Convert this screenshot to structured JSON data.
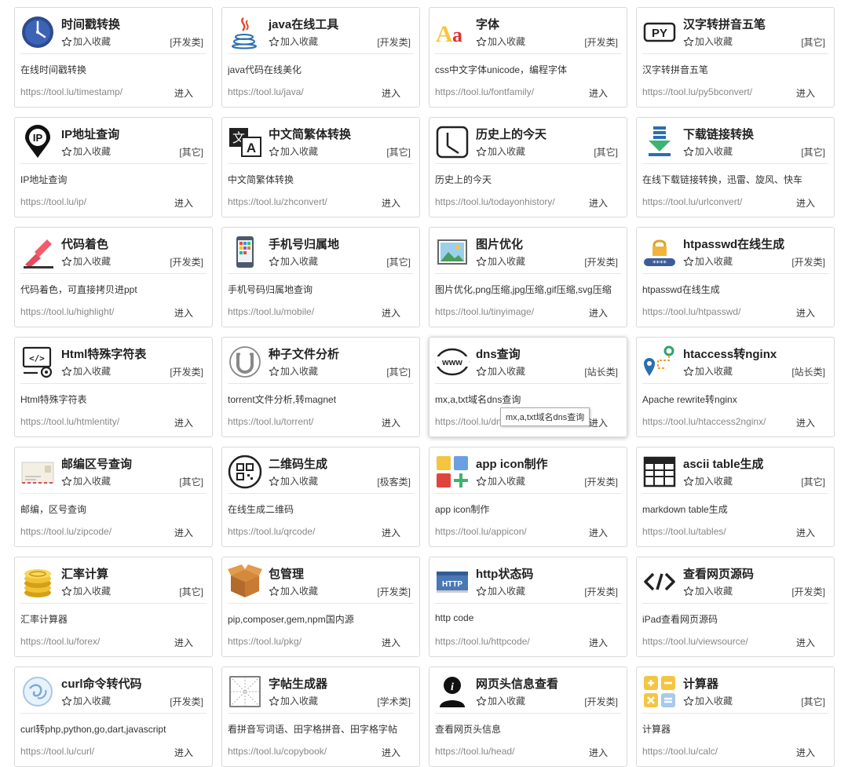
{
  "common": {
    "fav_label": "加入收藏",
    "enter_label": "进入"
  },
  "tooltip": "mx,a,txt域名dns查询",
  "tools": [
    {
      "icon": "clock-icon",
      "title": "时间戳转换",
      "category": "[开发类]",
      "desc": "在线时间戳转换",
      "url": "https://tool.lu/timestamp/"
    },
    {
      "icon": "java-icon",
      "title": "java在线工具",
      "category": "[开发类]",
      "desc": "java代码在线美化",
      "url": "https://tool.lu/java/"
    },
    {
      "icon": "font-icon",
      "title": "字体",
      "category": "[开发类]",
      "desc": "css中文字体unicode，编程字体",
      "url": "https://tool.lu/fontfamily/"
    },
    {
      "icon": "py-icon",
      "title": "汉字转拼音五笔",
      "category": "[其它]",
      "desc": "汉字转拼音五笔",
      "url": "https://tool.lu/py5bconvert/"
    },
    {
      "icon": "ip-pin-icon",
      "title": "IP地址查询",
      "category": "[其它]",
      "desc": "IP地址查询",
      "url": "https://tool.lu/ip/"
    },
    {
      "icon": "translate-icon",
      "title": "中文简繁体转换",
      "category": "[其它]",
      "desc": "中文简繁体转换",
      "url": "https://tool.lu/zhconvert/"
    },
    {
      "icon": "history-clock-icon",
      "title": "历史上的今天",
      "category": "[其它]",
      "desc": "历史上的今天",
      "url": "https://tool.lu/todayonhistory/"
    },
    {
      "icon": "download-icon",
      "title": "下载链接转换",
      "category": "[其它]",
      "desc": "在线下载链接转换，迅雷、旋风、快车",
      "url": "https://tool.lu/urlconvert/"
    },
    {
      "icon": "highlighter-icon",
      "title": "代码着色",
      "category": "[开发类]",
      "desc": "代码着色，可直接拷贝进ppt",
      "url": "https://tool.lu/highlight/"
    },
    {
      "icon": "mobile-icon",
      "title": "手机号归属地",
      "category": "[其它]",
      "desc": "手机号码归属地查询",
      "url": "https://tool.lu/mobile/"
    },
    {
      "icon": "image-icon",
      "title": "图片优化",
      "category": "[开发类]",
      "desc": "图片优化,png压缩,jpg压缩,gif压缩,svg压缩",
      "url": "https://tool.lu/tinyimage/"
    },
    {
      "icon": "password-lock-icon",
      "title": "htpasswd在线生成",
      "category": "[开发类]",
      "desc": "htpasswd在线生成",
      "url": "https://tool.lu/htpasswd/"
    },
    {
      "icon": "code-monitor-icon",
      "title": "Html特殊字符表",
      "category": "[开发类]",
      "desc": "Html特殊字符表",
      "url": "https://tool.lu/htmlentity/"
    },
    {
      "icon": "torrent-icon",
      "title": "种子文件分析",
      "category": "[其它]",
      "desc": "torrent文件分析,转magnet",
      "url": "https://tool.lu/torrent/"
    },
    {
      "icon": "www-icon",
      "title": "dns查询",
      "category": "[站长类]",
      "desc": "mx,a,txt域名dns查询",
      "url": "https://tool.lu/dns/"
    },
    {
      "icon": "route-icon",
      "title": "htaccess转nginx",
      "category": "[站长类]",
      "desc": "Apache rewrite转nginx",
      "url": "https://tool.lu/htaccess2nginx/"
    },
    {
      "icon": "envelope-icon",
      "title": "邮编区号查询",
      "category": "[其它]",
      "desc": "邮编，区号查询",
      "url": "https://tool.lu/zipcode/"
    },
    {
      "icon": "qrcode-icon",
      "title": "二维码生成",
      "category": "[极客类]",
      "desc": "在线生成二维码",
      "url": "https://tool.lu/qrcode/"
    },
    {
      "icon": "app-tiles-icon",
      "title": "app icon制作",
      "category": "[开发类]",
      "desc": "app icon制作",
      "url": "https://tool.lu/appicon/"
    },
    {
      "icon": "table-icon",
      "title": "ascii table生成",
      "category": "[其它]",
      "desc": "markdown table生成",
      "url": "https://tool.lu/tables/"
    },
    {
      "icon": "coins-icon",
      "title": "汇率计算",
      "category": "[其它]",
      "desc": "汇率计算器",
      "url": "https://tool.lu/forex/"
    },
    {
      "icon": "package-icon",
      "title": "包管理",
      "category": "[开发类]",
      "desc": "pip,composer,gem,npm国内源",
      "url": "https://tool.lu/pkg/"
    },
    {
      "icon": "http-icon",
      "title": "http状态码",
      "category": "[开发类]",
      "desc": "http code",
      "url": "https://tool.lu/httpcode/"
    },
    {
      "icon": "code-brackets-icon",
      "title": "查看网页源码",
      "category": "[开发类]",
      "desc": "iPad查看网页源码",
      "url": "https://tool.lu/viewsource/"
    },
    {
      "icon": "curl-icon",
      "title": "curl命令转代码",
      "category": "[开发类]",
      "desc": "curl转php,python,go,dart,javascript",
      "url": "https://tool.lu/curl/"
    },
    {
      "icon": "grid-paper-icon",
      "title": "字帖生成器",
      "category": "[学术类]",
      "desc": "看拼音写词语、田字格拼音、田字格字帖",
      "url": "https://tool.lu/copybook/"
    },
    {
      "icon": "info-person-icon",
      "title": "网页头信息查看",
      "category": "[开发类]",
      "desc": "查看网页头信息",
      "url": "https://tool.lu/head/"
    },
    {
      "icon": "calculator-icon",
      "title": "计算器",
      "category": "[其它]",
      "desc": "计算器",
      "url": "https://tool.lu/calc/"
    }
  ]
}
